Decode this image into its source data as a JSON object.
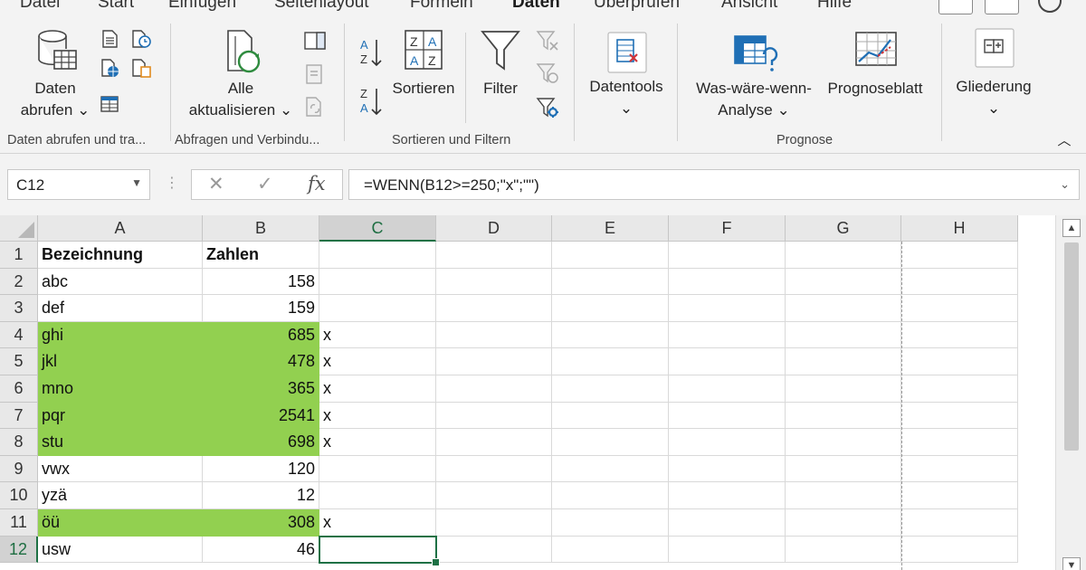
{
  "menu": {
    "tabs": [
      "Datei",
      "Start",
      "Einfügen",
      "Seitenlayout",
      "Formeln",
      "Daten",
      "Überprüfen",
      "Ansicht",
      "Hilfe"
    ],
    "active": "Daten"
  },
  "ribbon": {
    "get_data": {
      "line1": "Daten",
      "line2": "abrufen ⌄"
    },
    "refresh_all": {
      "line1": "Alle",
      "line2": "aktualisieren ⌄"
    },
    "sort": "Sortieren",
    "filter": "Filter",
    "datatools": {
      "line1": "Datentools",
      "line2": "⌄"
    },
    "whatif": {
      "line1": "Was-wäre-wenn-",
      "line2": "Analyse ⌄"
    },
    "forecast": "Prognoseblatt",
    "outline": {
      "line1": "Gliederung",
      "line2": "⌄"
    },
    "groups": {
      "get_transform": "Daten abrufen und tra...",
      "queries": "Abfragen und Verbindu...",
      "sort_filter": "Sortieren und Filtern",
      "forecast": "Prognose"
    },
    "collapse": "︿"
  },
  "formula_bar": {
    "name_box": "C12",
    "formula": "=WENN(B12>=250;\"x\";\"\")",
    "cancel": "✕",
    "enter": "✓",
    "fx": "fx"
  },
  "sheet": {
    "columns": [
      "A",
      "B",
      "C",
      "D",
      "E",
      "F",
      "G",
      "H"
    ],
    "selected_column": "C",
    "selected_row": "12",
    "highlight_color": "#92d050",
    "rows": [
      {
        "n": "1",
        "a": "Bezeichnung",
        "b": "Zahlen",
        "c": "",
        "header": true,
        "green": false
      },
      {
        "n": "2",
        "a": "abc",
        "b": "158",
        "c": "",
        "green": false
      },
      {
        "n": "3",
        "a": "def",
        "b": "159",
        "c": "",
        "green": false
      },
      {
        "n": "4",
        "a": "ghi",
        "b": "685",
        "c": "x",
        "green": true
      },
      {
        "n": "5",
        "a": "jkl",
        "b": "478",
        "c": "x",
        "green": true
      },
      {
        "n": "6",
        "a": "mno",
        "b": "365",
        "c": "x",
        "green": true
      },
      {
        "n": "7",
        "a": "pqr",
        "b": "2541",
        "c": "x",
        "green": true
      },
      {
        "n": "8",
        "a": "stu",
        "b": "698",
        "c": "x",
        "green": true
      },
      {
        "n": "9",
        "a": "vwx",
        "b": "120",
        "c": "",
        "green": false
      },
      {
        "n": "10",
        "a": "yzä",
        "b": "12",
        "c": "",
        "green": false
      },
      {
        "n": "11",
        "a": "öü",
        "b": "308",
        "c": "x",
        "green": true
      },
      {
        "n": "12",
        "a": "usw",
        "b": "46",
        "c": "",
        "green": false
      }
    ]
  }
}
